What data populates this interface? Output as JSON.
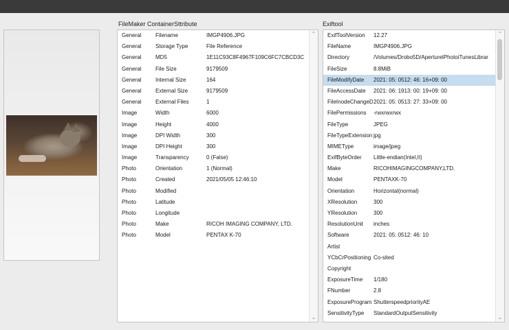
{
  "left_section": {
    "title": "FileMaker ContainerSttribute"
  },
  "right_section": {
    "title": "Exiftool"
  },
  "scroll": {
    "up_glyph": "⌃",
    "down_glyph": "⌄"
  },
  "filemaker_rows": [
    [
      "General",
      "Filename",
      "IMGP4906.JPG"
    ],
    [
      "General",
      "Storage Type",
      "File Reference"
    ],
    [
      "General",
      "MD5",
      "1E11C93C8F4967F109C6FC7CBCD3C"
    ],
    [
      "General",
      "File Size",
      "9179509"
    ],
    [
      "General",
      "Internal Size",
      "164"
    ],
    [
      "General",
      "External Size",
      "9179509"
    ],
    [
      "General",
      "External Files",
      "1"
    ],
    [
      "Image",
      "Width",
      "6000"
    ],
    [
      "Image",
      "Height",
      "4000"
    ],
    [
      "Image",
      "DPI Width",
      "300"
    ],
    [
      "Image",
      "DPI Height",
      "300"
    ],
    [
      "Image",
      "Transparency",
      "0 (False)"
    ],
    [
      "Photo",
      "Orientation",
      "1 (Normal)"
    ],
    [
      "Photo",
      "Created",
      "2021/05/05 12:46:10"
    ],
    [
      "Photo",
      "Modified",
      ""
    ],
    [
      "Photo",
      "Latitude",
      ""
    ],
    [
      "Photo",
      "Longitude",
      ""
    ],
    [
      "Photo",
      "Make",
      "RICOH IMAGING COMPANY, LTD."
    ],
    [
      "Photo",
      "Model",
      "PENTAX K-70"
    ]
  ],
  "exif_rows": [
    [
      "ExifToolVersion",
      "12.27"
    ],
    [
      "FileName",
      "IMGP4906.JPG"
    ],
    [
      "Directory",
      "/Volumes/Drobo5D/AperturelPhotoiTunesLibrar"
    ],
    [
      "FileSize",
      "8.8MiB"
    ],
    [
      "FileModifyDate",
      "2021: 05: 0512: 46: 16+09: 00"
    ],
    [
      "FileAccessDate",
      "2021: 06: 1913: 00: 19+09: 00"
    ],
    [
      "FileInodeChangeD",
      "2021: 05: 0513: 27: 33+09: 00"
    ],
    [
      "FilePermissions",
      "-rwxrwxrwx"
    ],
    [
      "FileType",
      "JPEG"
    ],
    [
      "FileTypeExtension",
      "jpg"
    ],
    [
      "MIMEType",
      "image/jpeg"
    ],
    [
      "ExifByteOrder",
      "Little-endian(Intel,II)"
    ],
    [
      "Make",
      "RICOHIMAGINGCOMPANY,LTD."
    ],
    [
      "Model",
      "PENTAXK-70"
    ],
    [
      "Orientation",
      "Horizontal(normal)"
    ],
    [
      "XResolution",
      "300"
    ],
    [
      "YResolution",
      "300"
    ],
    [
      "ResolutionUnit",
      "inches"
    ],
    [
      "Software",
      "2021: 05: 0512: 46: 10"
    ],
    [
      "Artist",
      ""
    ],
    [
      "YCbCrPositioning",
      "Co-sited"
    ],
    [
      "Copyright",
      ""
    ],
    [
      "ExposureTime",
      "1/180"
    ],
    [
      "FNumber",
      "2.8"
    ],
    [
      "ExposureProgram",
      "ShutterspeedpriorityAE"
    ],
    [
      "SensitivityType",
      "StandardOutputSensitivity"
    ]
  ],
  "selected_exif_row": 4
}
